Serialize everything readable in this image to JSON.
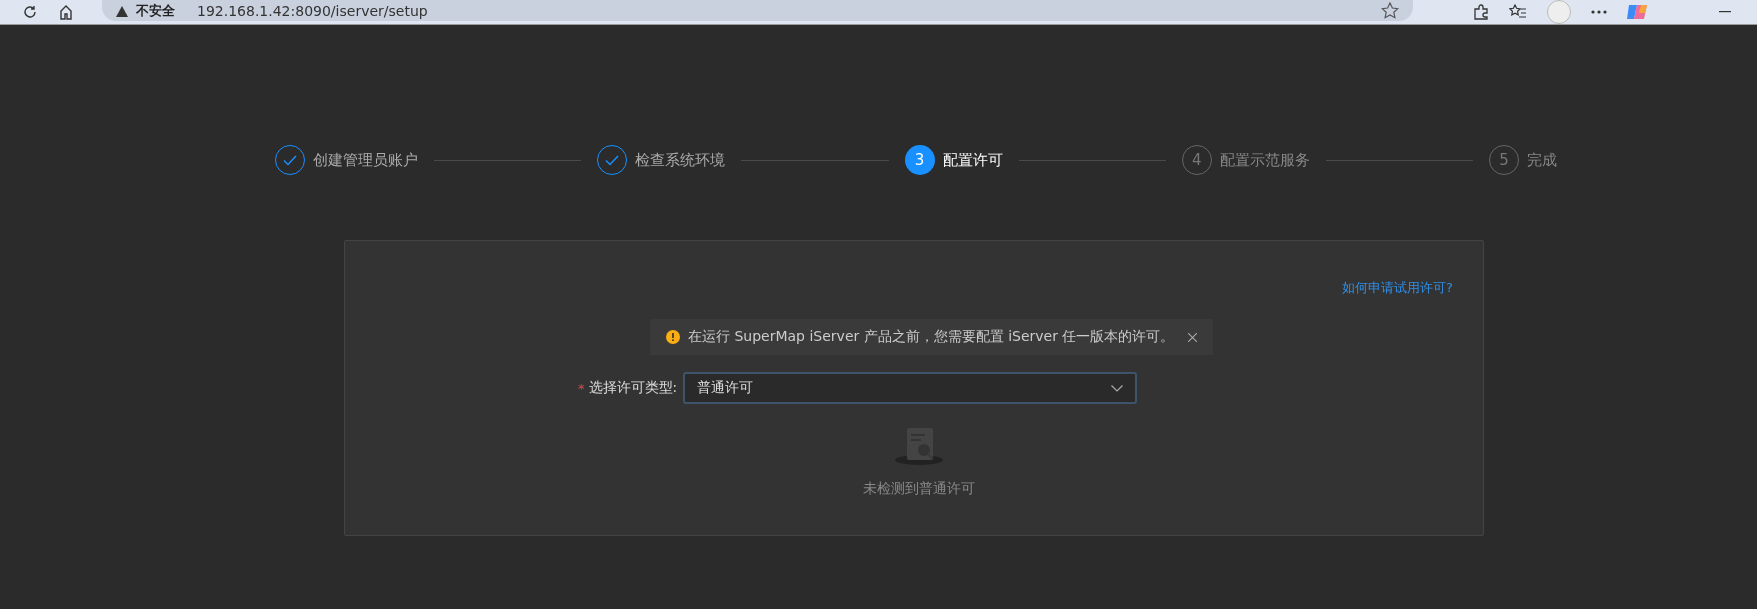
{
  "browser": {
    "security": "不安全",
    "url": "192.168.1.42:8090/iserver/setup"
  },
  "steps": [
    {
      "title": "创建管理员账户",
      "done": true
    },
    {
      "title": "检查系统环境",
      "done": true
    },
    {
      "number": "3",
      "title": "配置许可",
      "done": false,
      "current": true
    },
    {
      "number": "4",
      "title": "配置示范服务",
      "done": false,
      "current": false
    },
    {
      "number": "5",
      "title": "完成",
      "done": false,
      "current": false
    }
  ],
  "panel": {
    "help_link": "如何申请试用许可?",
    "alert": {
      "message": "在运行 SuperMap iServer 产品之前，您需要配置 iServer 任一版本的许可。"
    },
    "license_type": {
      "required_mark": "*",
      "label": "选择许可类型:",
      "value": "普通许可"
    },
    "empty": {
      "text": "未检测到普通许可"
    }
  }
}
